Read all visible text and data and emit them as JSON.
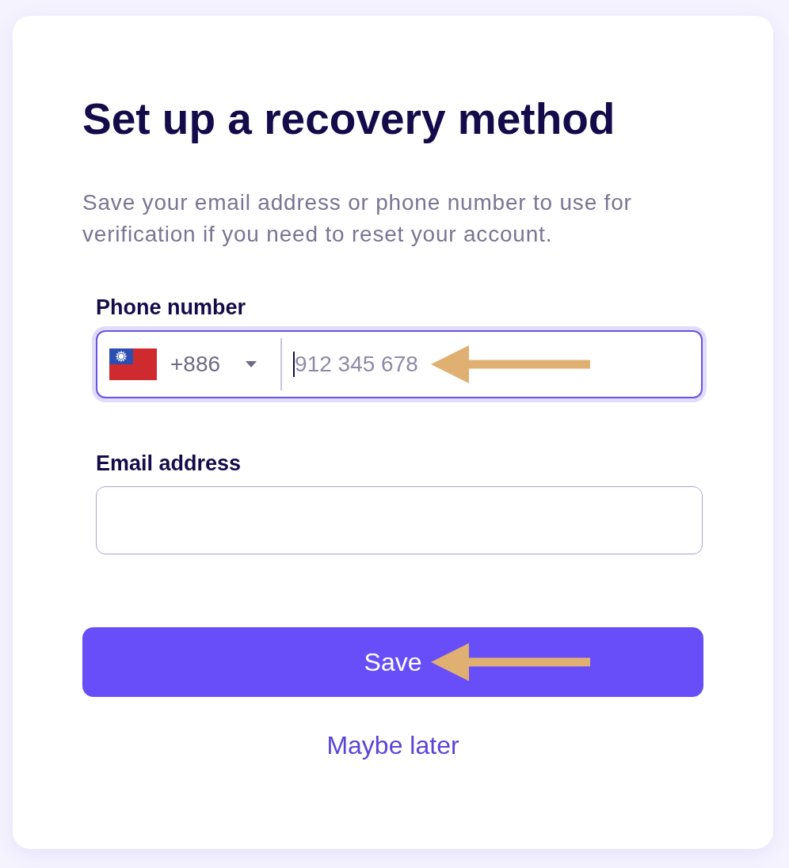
{
  "card": {
    "title": "Set up a recovery method",
    "description": "Save your email address or phone number to use for verification if you need to reset your account."
  },
  "fields": [
    {
      "kind": "phone",
      "label": "Phone number",
      "country_code": "+886",
      "placeholder": "912 345 678",
      "focused": true,
      "arrow": true
    },
    {
      "kind": "email",
      "label": "Email address",
      "focused": false,
      "arrow": false
    }
  ],
  "primary_button": {
    "label": "Save",
    "arrow": true
  },
  "secondary_link": {
    "label": "Maybe later"
  }
}
